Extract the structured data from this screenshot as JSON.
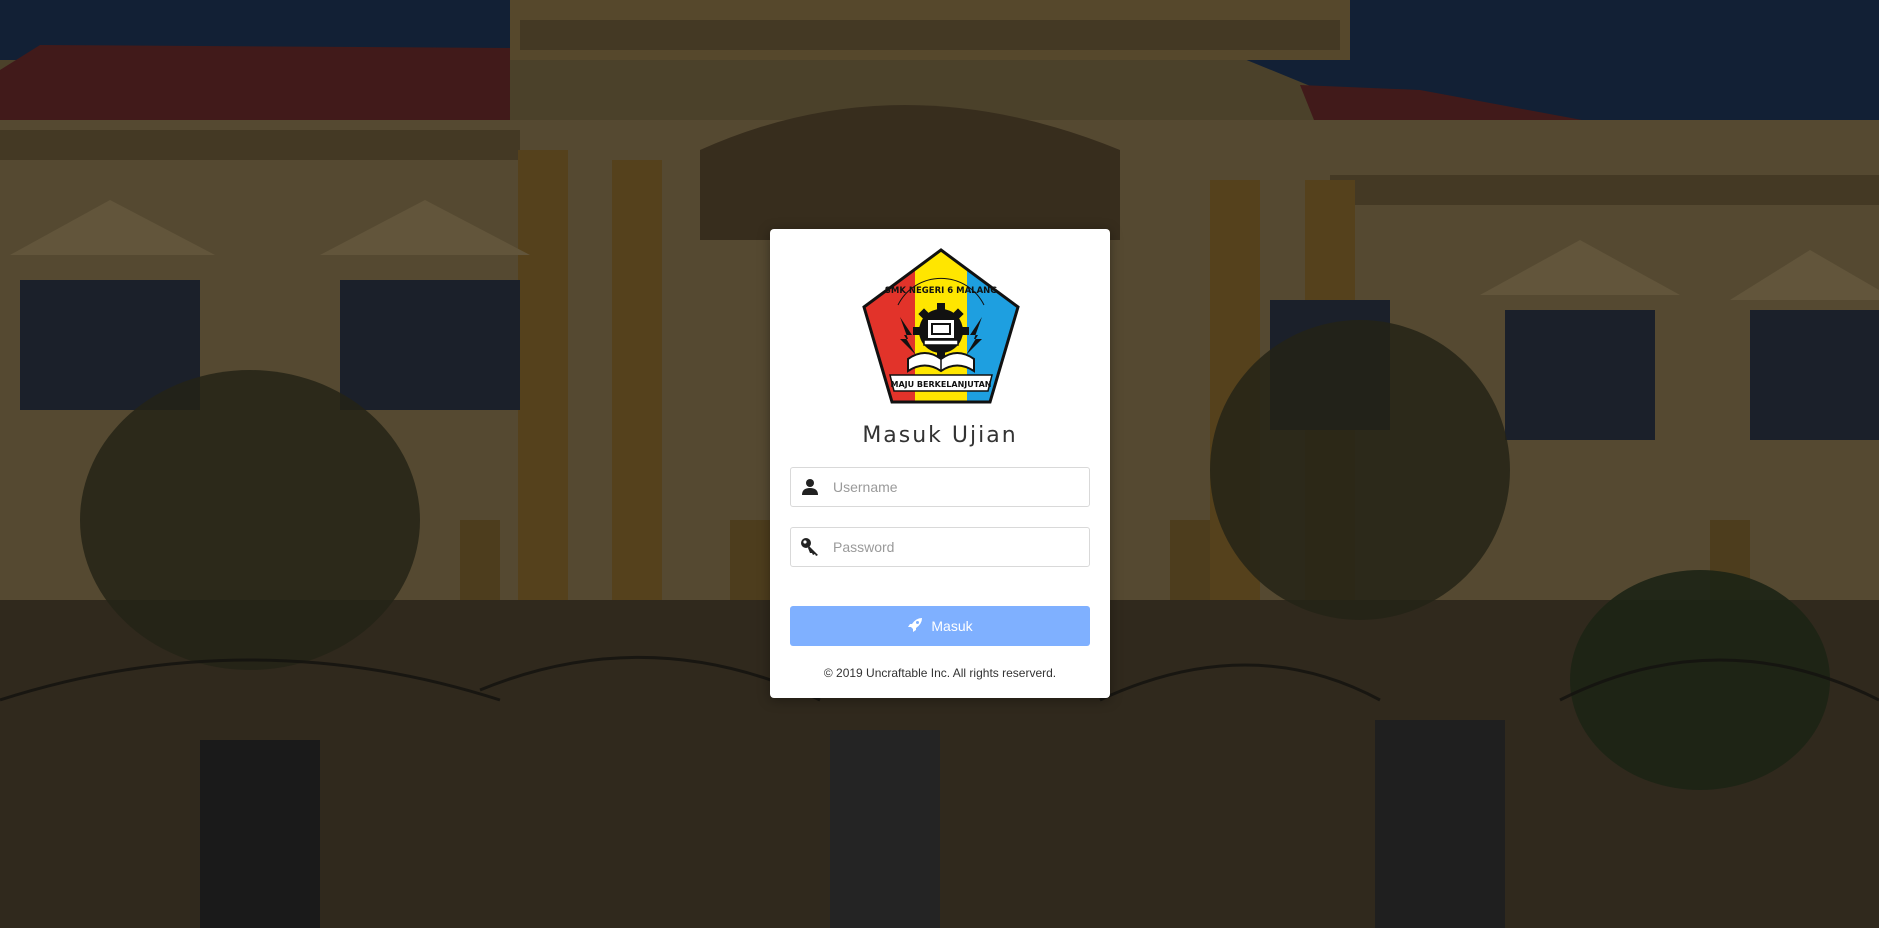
{
  "login": {
    "title": "Masuk Ujian",
    "username_placeholder": "Username",
    "password_placeholder": "Password",
    "submit_label": "Masuk",
    "footer": "© 2019 Uncraftable Inc. All rights reserverd."
  },
  "logo": {
    "top_text": "SMK NEGERI 6 MALANG",
    "motto": "MAJU BERKELANJUTAN"
  },
  "icons": {
    "username": "user-icon",
    "password": "key-icon",
    "submit": "rocket-icon"
  },
  "colors": {
    "button": "#7fb0ff",
    "logo_red": "#e2332a",
    "logo_yellow": "#ffe600",
    "logo_blue": "#1e9fe0"
  }
}
